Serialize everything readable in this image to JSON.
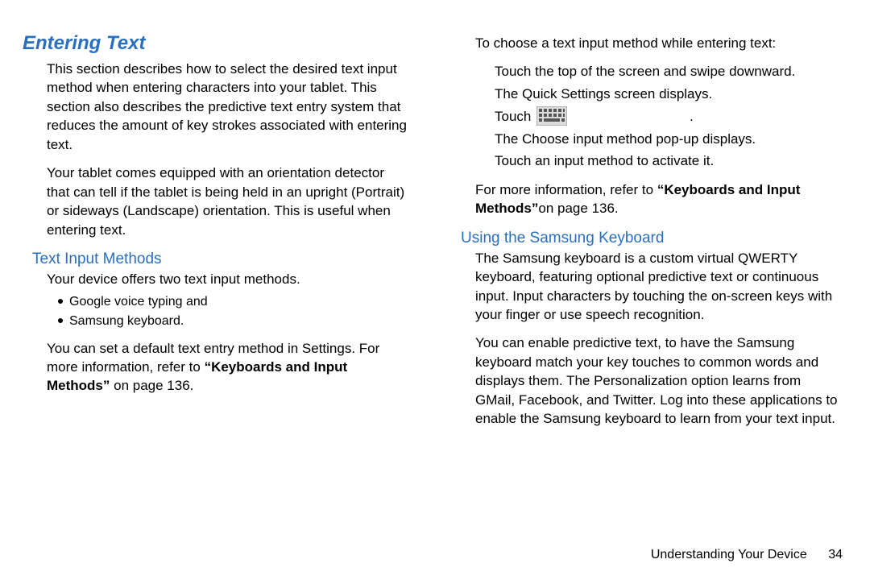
{
  "left": {
    "sectionTitle": "Entering Text",
    "p1": "This section describes how to select the desired text input method when entering characters into your tablet. This section also describes the predictive text entry system that reduces the amount of key strokes associated with entering text.",
    "p2": "Your tablet comes equipped with an orientation detector that can tell if the tablet is being held in an upright (Portrait) or sideways (Landscape) orientation. This is useful when entering text.",
    "subhead1": "Text Input Methods",
    "p3": "Your device offers two text input methods.",
    "bullets": [
      "Google voice typing and",
      "Samsung keyboard."
    ],
    "p4_pre": "You can set a default text entry method in Settings. For more information, refer to ",
    "p4_bold": "“Keyboards and Input Methods”",
    "p4_post": " on page 136."
  },
  "right": {
    "r1": "To choose a text input method while entering text:",
    "r2": "Touch the top of the screen and swipe downward.",
    "r3": "The Quick Settings screen displays.",
    "r4_pre": "Touch ",
    "r4_post": ".",
    "r5": "The Choose input method pop-up displays.",
    "r6": "Touch an input method to activate it.",
    "r7_pre": "For more information, refer to ",
    "r7_bold": "“Keyboards and Input Methods”",
    "r7_post": "on page 136.",
    "subhead2": "Using the Samsung Keyboard",
    "r8": "The Samsung keyboard is a custom virtual QWERTY keyboard, featuring optional predictive text or continuous input. Input characters by touching the on-screen keys with your finger or use speech recognition.",
    "r9": "You can enable predictive text, to have the Samsung keyboard match your key touches to common words and displays them. The Personalization option learns from GMail, Facebook, and Twitter. Log into these applications to enable the Samsung keyboard to learn from your text input."
  },
  "footer": {
    "chapter": "Understanding Your Device",
    "page": "34"
  }
}
